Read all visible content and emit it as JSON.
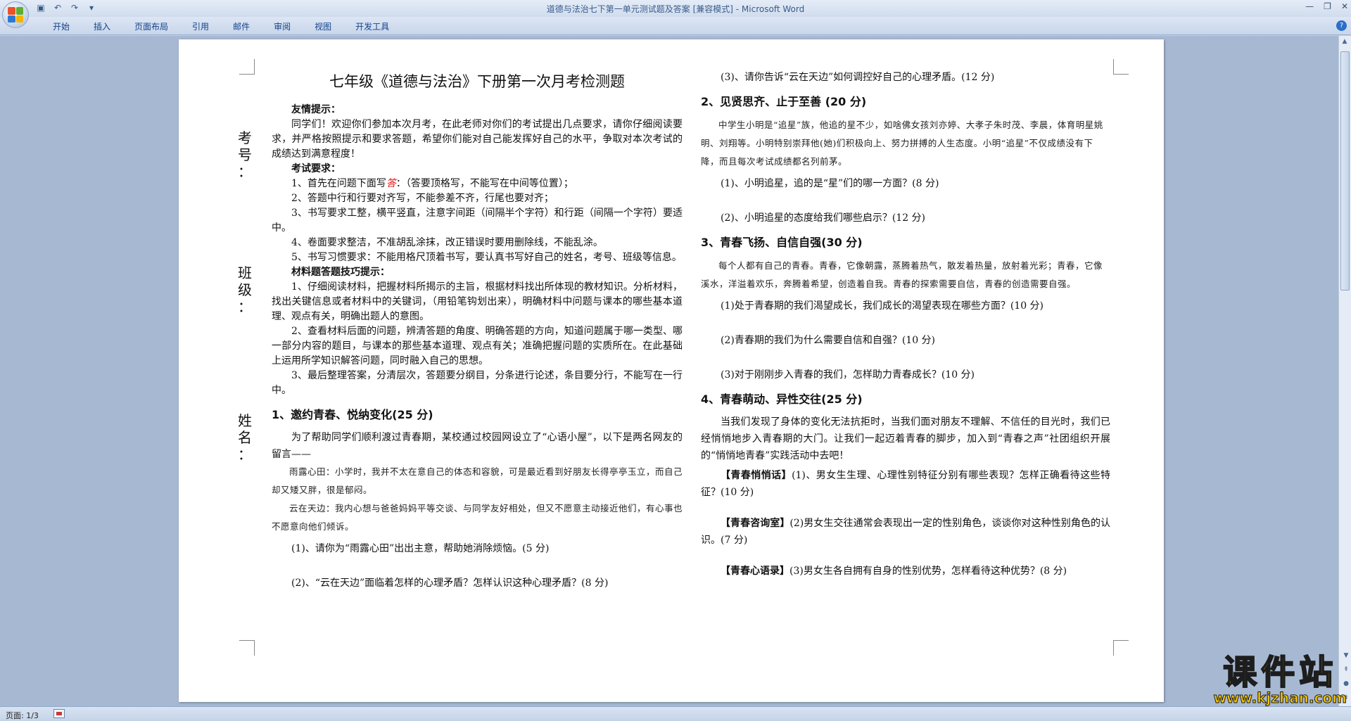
{
  "window": {
    "title": "道德与法治七下第一单元测试题及答案 [兼容模式] - Microsoft Word",
    "controls": [
      "—",
      "❐",
      "✕"
    ]
  },
  "qat": [
    "save-icon",
    "undo-icon",
    "redo-icon"
  ],
  "ribbon": {
    "tabs": [
      "开始",
      "插入",
      "页面布局",
      "引用",
      "邮件",
      "审阅",
      "视图",
      "开发工具"
    ]
  },
  "side_labels": {
    "kaohao": [
      "考",
      "号",
      "："
    ],
    "banji": [
      "班",
      "级",
      "："
    ],
    "xingming": [
      "姓",
      "名",
      "："
    ]
  },
  "left": {
    "title": "七年级《道德与法治》下册第一次月考检测题",
    "tip_head": "友情提示：",
    "tip_body": "同学们！欢迎你们参加本次月考，在此老师对你们的考试提出几点要求，请你仔细阅读要求，并严格按照提示和要求答题，希望你们能对自己能发挥好自己的水平，争取对本次考试的成绩达到满意程度！",
    "req_head": "考试要求：",
    "req_1a": "1、首先在问题下面写",
    "req_1_red": "答",
    "req_1b": "：（答要顶格写，不能写在中间等位置）；",
    "req_2": "2、答题中行和行要对齐写，不能参差不齐，行尾也要对齐；",
    "req_3": "3、书写要求工整，横平竖直，注意字间距（间隔半个字符）和行距（间隔一个字符）要适中。",
    "req_4": "4、卷面要求整洁，不准胡乱涂抹，改正错误时要用删除线，不能乱涂。",
    "req_5": "5、书写习惯要求：不能用格尺顶着书写，要认真书写好自己的姓名，考号、班级等信息。",
    "skill_head": "材料题答题技巧提示：",
    "skill_1": "1、仔细阅读材料，把握材料所揭示的主旨，根据材料找出所体现的教材知识。分析材料，找出关键信息或者材料中的关键词，（用铅笔钩划出来），明确材料中问题与课本的哪些基本道理、观点有关，明确出题人的意图。",
    "skill_2": "2、查看材料后面的问题，辨清答题的角度、明确答题的方向，知道问题属于哪一类型、哪一部分内容的题目，与课本的那些基本道理、观点有关；准确把握问题的实质所在。在此基础上运用所学知识解答问题，同时融入自己的思想。",
    "skill_3": "3、最后整理答案，分清层次，答题要分纲目，分条进行论述，条目要分行，不能写在一行中。",
    "sec1_head": "1、邀约青春、悦纳变化(25 分)",
    "sec1_intro": "为了帮助同学们顺利渡过青春期，某校通过校园网设立了“心语小屋”，以下是两名网友的留言——",
    "sec1_msg1": "雨露心田：小学时，我并不太在意自己的体态和容貌，可是最近看到好朋友长得亭亭玉立，而自己却又矮又胖，很是郁闷。",
    "sec1_msg2": "云在天边：我内心想与爸爸妈妈平等交谈、与同学友好相处，但又不愿意主动接近他们，有心事也不愿意向他们倾诉。",
    "sec1_q1": "(1)、请你为“雨露心田”出出主意，帮助她消除烦恼。(5 分)",
    "sec1_q2": "(2)、“云在天边”面临着怎样的心理矛盾？怎样认识这种心理矛盾？(8 分)"
  },
  "right": {
    "sec1_q3": "(3)、请你告诉“云在天边”如何调控好自己的心理矛盾。(12 分)",
    "sec2_head": "2、见贤思齐、止于至善 (20 分)",
    "sec2_text": "中学生小明是“追星”族，他追的星不少，如啥佛女孩刘亦婷、大孝子朱时茂、李晨，体育明星姚明、刘翔等。小明特别崇拜他(她)们积极向上、努力拼搏的人生态度。小明“追星”不仅成绩没有下降，而且每次考试成绩都名列前茅。",
    "sec2_q1": "(1)、小明追星，追的是“星”们的哪一方面？(8 分)",
    "sec2_q2": "(2)、小明追星的态度给我们哪些启示？(12 分)",
    "sec3_head": "3、青春飞扬、自信自强(30 分)",
    "sec3_text": "每个人都有自己的青春。青春，它像朝露，蒸腾着热气，散发着热量，放射着光彩；青春，它像溪水，洋溢着欢乐，奔腾着希望，创造着自我。青春的探索需要自信，青春的创造需要自强。",
    "sec3_q1": "(1)处于青春期的我们渴望成长，我们成长的渴望表现在哪些方面？(10 分)",
    "sec3_q2": "(2)青春期的我们为什么需要自信和自强？(10 分)",
    "sec3_q3": "(3)对于刚刚步入青春的我们，怎样助力青春成长？(10 分)",
    "sec4_head": "4、青春萌动、异性交往(25 分)",
    "sec4_intro": "当我们发现了身体的变化无法抗拒时，当我们面对朋友不理解、不信任的目光时，我们已经悄悄地步入青春期的大门。让我们一起迈着青春的脚步，加入到“青春之声”社团组织开展的“悄悄地青春”实践活动中去吧！",
    "sec4_q1_tag": "【青春悄悄话】",
    "sec4_q1": "(1)、男女生生理、心理性别特征分别有哪些表现？怎样正确看待这些特征？(10 分)",
    "sec4_q2_tag": "【青春咨询室】",
    "sec4_q2": "(2)男女生交往通常会表现出一定的性别角色，谈谈你对这种性别角色的认识。(7 分)",
    "sec4_q3_tag": "【青春心语录】",
    "sec4_q3": "(3)男女生各自拥有自身的性别优势，怎样看待这种优势？(8 分)"
  },
  "status": {
    "page": "页面: 1/3"
  },
  "watermark": {
    "main": "课件站",
    "url": "www.kjzhan.com"
  },
  "colors": {
    "accent": "#15428b",
    "watermark": "#f4c300",
    "red_mark": "#dd1111"
  }
}
